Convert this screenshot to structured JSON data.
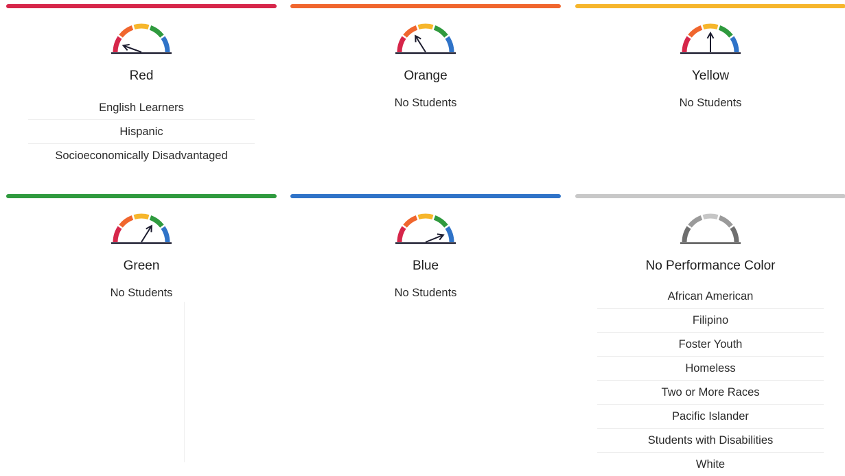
{
  "colors": {
    "red": "#d6264a",
    "orange": "#f0662e",
    "yellow": "#f6b62c",
    "green": "#2f9a3e",
    "blue": "#2f73c8",
    "gray_bar": "#c8c8c8",
    "gauge_gray_dark": "#6f6f6f",
    "gauge_gray_mid": "#9a9a9a",
    "gauge_gray_light": "#c6c6c6",
    "needle": "#1b1b2e"
  },
  "cards": [
    {
      "key": "red",
      "title": "Red",
      "gauge_level": "red",
      "groups": [
        "English Learners",
        "Hispanic",
        "Socioeconomically Disadvantaged"
      ],
      "no_students_text": ""
    },
    {
      "key": "orange",
      "title": "Orange",
      "gauge_level": "orange",
      "groups": [],
      "no_students_text": "No Students"
    },
    {
      "key": "yellow",
      "title": "Yellow",
      "gauge_level": "yellow",
      "groups": [],
      "no_students_text": "No Students"
    },
    {
      "key": "green",
      "title": "Green",
      "gauge_level": "green",
      "groups": [],
      "no_students_text": "No Students"
    },
    {
      "key": "blue",
      "title": "Blue",
      "gauge_level": "blue",
      "groups": [],
      "no_students_text": "No Students"
    },
    {
      "key": "none",
      "title": "No Performance Color",
      "gauge_level": "none",
      "groups": [
        "African American",
        "Filipino",
        "Foster Youth",
        "Homeless",
        "Two or More Races",
        "Pacific Islander",
        "Students with Disabilities",
        "White"
      ],
      "no_students_text": ""
    }
  ]
}
